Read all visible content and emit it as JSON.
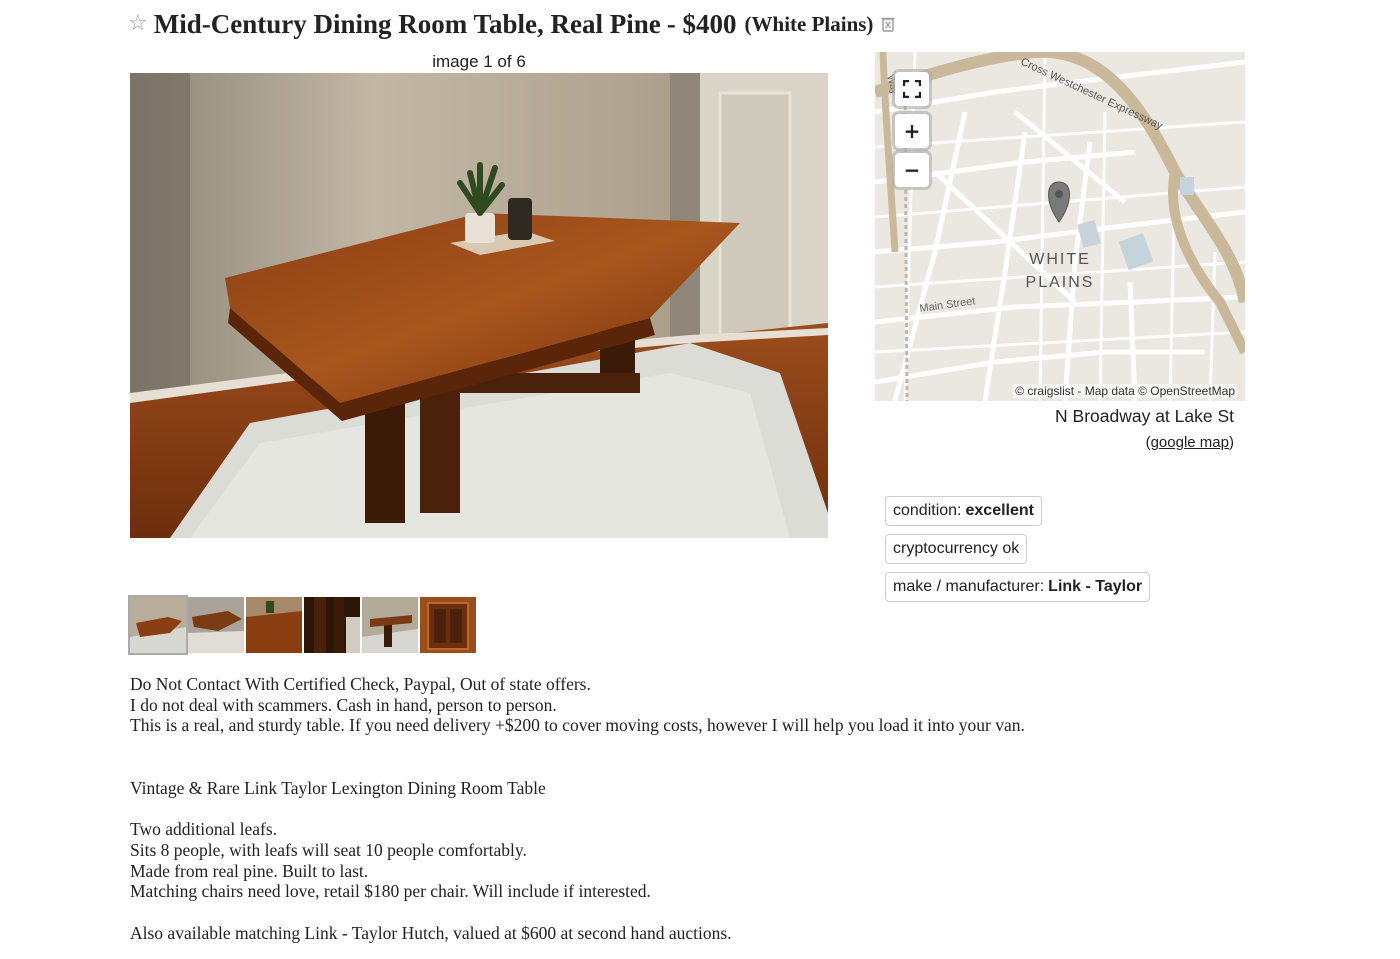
{
  "listing": {
    "title": "Mid-Century Dining Room Table, Real Pine",
    "price": "- $400",
    "location": "(White Plains)",
    "icons": {
      "favorite": "star-icon",
      "hide": "trash-icon"
    }
  },
  "gallery": {
    "counter": "image 1 of 6",
    "thumb_count": 6,
    "selected_index": 0
  },
  "map": {
    "labels": [
      "Cross Westchester Expressway",
      "WHITE",
      "PLAINS",
      "Main Street",
      "Way"
    ],
    "attribution": "© craigslist - Map data © OpenStreetMap",
    "controls": {
      "fullscreen": "fullscreen-icon",
      "zoom_in": "+",
      "zoom_out": "−"
    },
    "address": "N Broadway at Lake St",
    "google_open": "(",
    "google_link": "google map",
    "google_close": ")"
  },
  "attributes": [
    {
      "label": "condition:",
      "value": "excellent"
    },
    {
      "label": "cryptocurrency ok",
      "value": ""
    },
    {
      "label": "make / manufacturer:",
      "value": "Link - Taylor"
    }
  ],
  "description": {
    "block1": [
      "Do Not Contact With Certified Check, Paypal, Out of state offers.",
      "I do not deal with scammers. Cash in hand, person to person.",
      "This is a real, and sturdy table. If you need delivery +$200 to cover moving costs, however I will help you load it into your van."
    ],
    "heading": "Vintage & Rare Link Taylor Lexington Dining Room Table",
    "block2": [
      "Two additional leafs.",
      "Sits 8 people, with leafs will seat 10 people comfortably.",
      "Made from real pine. Built to last.",
      "Matching chairs need love, retail $180 per chair. Will include if interested."
    ],
    "footer": "Also available matching Link - Taylor Hutch, valued at $600 at second hand auctions."
  },
  "colors": {
    "wood": "#7a3a12",
    "wall": "#b9ad9b",
    "map_road": "#c9b89a",
    "text": "#222222"
  }
}
